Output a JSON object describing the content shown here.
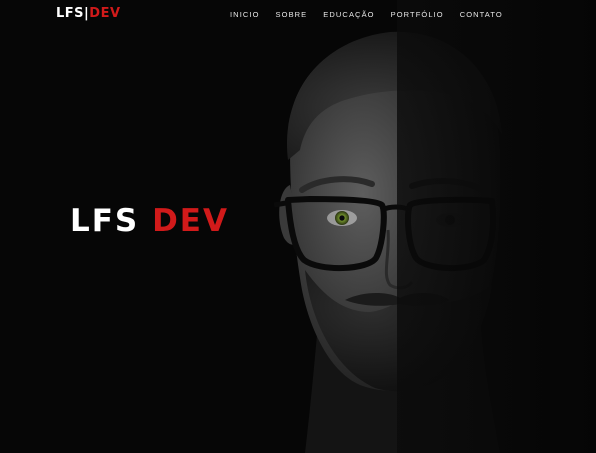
{
  "header": {
    "brand_left": "LFS",
    "brand_sep": "|",
    "brand_right": "DEV",
    "nav": [
      {
        "label": "INICIO"
      },
      {
        "label": "SOBRE"
      },
      {
        "label": "EDUCAÇÃO"
      },
      {
        "label": "PORTFÓLIO"
      },
      {
        "label": "CONTATO"
      }
    ]
  },
  "hero": {
    "title_left": "LFS",
    "title_right": "DEV",
    "portrait_icon": "portrait-photo"
  },
  "colors": {
    "background": "#060606",
    "accent": "#d11a1a",
    "text": "#ffffff"
  }
}
